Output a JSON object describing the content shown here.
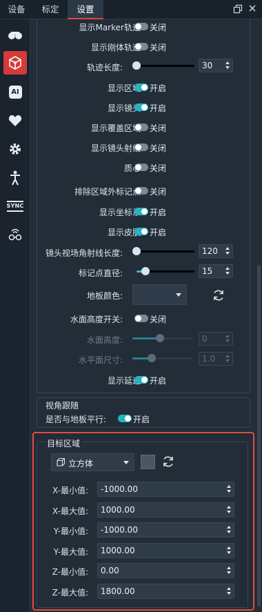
{
  "tabs": [
    {
      "label": "设备"
    },
    {
      "label": "标定"
    },
    {
      "label": "设置"
    }
  ],
  "sidebar": {
    "items": [
      {
        "icon": "cameras-icon"
      },
      {
        "icon": "rigidbody-icon",
        "active": true
      },
      {
        "icon": "ai-icon"
      },
      {
        "icon": "heart-icon"
      },
      {
        "icon": "gear-icon"
      },
      {
        "icon": "person-icon"
      },
      {
        "icon": "sync-icon"
      },
      {
        "icon": "wireless-glasses-icon"
      }
    ],
    "sync_text": "SYNC",
    "ai_text": "AI"
  },
  "display": {
    "marker_trail": {
      "label": "显示Marker轨迹:",
      "state": "关闭"
    },
    "rigid_trail": {
      "label": "显示刚体轨迹:",
      "state": "关闭"
    },
    "trail_length": {
      "label": "轨迹长度:",
      "value": "30",
      "fraction": 0.0
    },
    "show_area": {
      "label": "显示区域:",
      "state": "开启"
    },
    "show_lens": {
      "label": "显示镜头:",
      "state": "开启"
    },
    "show_coverage": {
      "label": "显示覆盖区域:",
      "state": "关闭"
    },
    "show_lens_ray": {
      "label": "显示镜头射线:",
      "state": "关闭"
    },
    "centroid": {
      "label": "质心:",
      "state": "关闭"
    },
    "exclude_outside": {
      "label": "排除区域外标记点:",
      "state": "关闭"
    },
    "show_axes": {
      "label": "显示坐标系:",
      "state": "开启"
    },
    "show_skin": {
      "label": "显示皮肤:",
      "state": "开启"
    },
    "fov_ray_length": {
      "label": "镜头视场角射线长度:",
      "value": "120",
      "fraction": 0.0
    },
    "marker_diameter": {
      "label": "标记点直径:",
      "value": "15",
      "fraction": 0.15
    },
    "floor_color": {
      "label": "地板颜色:",
      "value": ""
    },
    "water_switch": {
      "label": "水面高度开关:",
      "state": "关闭"
    },
    "water_height": {
      "label": "水面高度:",
      "value": "0",
      "fraction": 0.45
    },
    "water_size": {
      "label": "水平面尺寸:",
      "value": "1.0",
      "fraction": 0.32
    },
    "show_delay": {
      "label": "显示延迟:",
      "state": "开启"
    }
  },
  "view_follow": {
    "title": "视角跟随",
    "parallel": {
      "label": "是否与地板平行:",
      "state": "开启"
    }
  },
  "target_area": {
    "title": "目标区域",
    "shape": {
      "value": "立方体"
    },
    "fields": [
      {
        "label": "X-最小值:",
        "value": "-1000.00"
      },
      {
        "label": "X-最大值:",
        "value": "1000.00"
      },
      {
        "label": "Y-最小值:",
        "value": "-1000.00"
      },
      {
        "label": "Y-最大值:",
        "value": "1000.00"
      },
      {
        "label": "Z-最小值:",
        "value": "0.00"
      },
      {
        "label": "Z-最大值:",
        "value": "1800.00"
      }
    ]
  },
  "colors": {
    "accent": "#e0473e",
    "toggle_on": "#26b3c2",
    "highlight_border": "#e54c41"
  }
}
